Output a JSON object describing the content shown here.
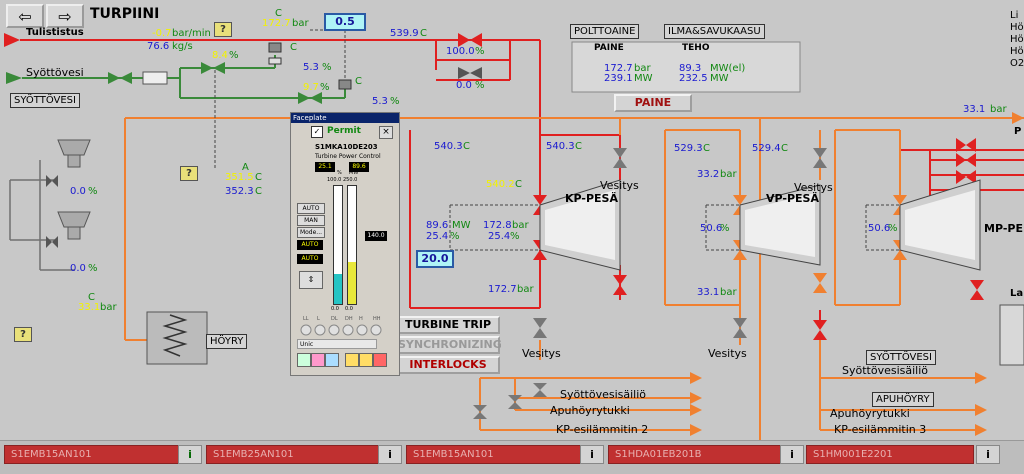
{
  "header": {
    "title": "TURPIINI",
    "back_label": "⇦",
    "forward_label": "⇨",
    "corner_label": "0.5"
  },
  "help_label": "?",
  "colors": {
    "background": "#c8c8c8",
    "red_line": "#e02020",
    "orange_line": "#f08030",
    "green_line": "#3a8a3a",
    "value_blue": "#1a1ad0",
    "value_yellow": "#f2f200",
    "alarm_red": "#c03030"
  },
  "top": {
    "tulististus": "Tulististus",
    "rate": "-0.7",
    "rate_unit": "bar/min",
    "flow": "76.6",
    "flow_unit": "kg/s",
    "valve_pct": "8.4",
    "pct_unit": "%",
    "p_top": "172.7",
    "p_top_unit": "bar",
    "c_lbl": "C",
    "p_temp": "539.9",
    "c_unit": "C",
    "pct_a": "5.3",
    "pct_b": "9.7",
    "pct_c": "5.3",
    "bypass_a": "100.0",
    "bypass_b": "0.0",
    "syottovesi": "Syöttövesi",
    "syottovesi_tag": "SYÖTTÖVESI"
  },
  "polttoaine": {
    "title_a": "POLTTOAINE",
    "title_b": "ILMA&SAVUKAASU",
    "paine_hdr": "PAINE",
    "teho_hdr": "TEHO",
    "paine1": "172.7",
    "paine1_unit": "bar",
    "paine2": "239.1",
    "paine2_unit": "MW",
    "teho1": "89.3",
    "teho1_unit": "MW(el)",
    "teho2": "232.5",
    "teho2_unit": "MW",
    "button": "PAINE"
  },
  "right_edge": {
    "labels": [
      "Li",
      "Hö",
      "Hö",
      "Hö",
      "O2"
    ],
    "value": "33.1",
    "unit": "bar",
    "pest_label": "P",
    "la_label": "La"
  },
  "left": {
    "pct1": "0.0",
    "pct2": "0.0",
    "pct_unit": "%",
    "temp_a_lbl": "A",
    "temp_a": "351.5",
    "temp_b": "352.3",
    "c_unit": "C",
    "p_small_lbl": "C",
    "p_small": "33.1",
    "bar_unit": "bar",
    "hoyry": "HÖYRY"
  },
  "faceplate": {
    "title": "Faceplate",
    "permit": "Permit",
    "close": "×",
    "tag": "S1MKA10DE203",
    "desc": "Turbine Power Control",
    "val_left": "25.1",
    "val_right": "89.6",
    "unit_left": "%",
    "unit_right": "MW",
    "scale_top": "100.0",
    "scale_top2": "250.0",
    "setpoint": "140.0",
    "btn_auto": "AUTO",
    "btn_man": "MAN",
    "btn_mode": "Mode...",
    "status_auto1": "AUTO",
    "status_auto2": "AUTO",
    "zero_a": "0.0",
    "zero_b": "0.0",
    "leds": [
      "LL",
      "L",
      "DL",
      "DH",
      "H",
      "HH"
    ],
    "unit_box": "Unic"
  },
  "buttons": {
    "trip": "TURBINE TRIP",
    "sync": "SYNCHRONIZING",
    "interlocks": "INTERLOCKS"
  },
  "kp": {
    "label": "KP-PESÄ",
    "t1": "540.3",
    "t2": "540.3",
    "t_yel": "540.2",
    "c_unit": "C",
    "mw": "89.6",
    "mw_unit": "MW",
    "pct_l": "25.4",
    "pct_unit": "%",
    "bar_r": "172.8",
    "bar_unit": "bar",
    "pct_r": "25.4",
    "setpoint": "20.0",
    "bar_bottom": "172.7",
    "vesitys1": "Vesitys",
    "vesitys2": "Vesitys"
  },
  "vp": {
    "label": "VP-PESÄ",
    "t1": "529.3",
    "t2": "529.4",
    "c_unit": "C",
    "bar_a": "33.2",
    "bar_unit": "bar",
    "pct": "50.6",
    "pct_unit": "%",
    "bar_b": "33.1",
    "vesitys1": "Vesitys",
    "vesitys2": "Vesitys"
  },
  "mp": {
    "label": "MP-PE",
    "pct": "50.6",
    "pct_unit": "%"
  },
  "outlets": {
    "left": [
      "Syöttövesisäiliö",
      "Apuhöyrytukki",
      "KP-esilämmitin 2"
    ],
    "right": [
      "Syöttövesisäiliö",
      "Apuhöyrytukki",
      "KP-esilämmitin 3"
    ],
    "tag_syottovesi": "SYÖTTÖVESI",
    "tag_apuhoyry": "APUHÖYRY"
  },
  "alarms": [
    {
      "tag": "S1EMB15AN101"
    },
    {
      "tag": "S1EMB25AN101"
    },
    {
      "tag": "S1EMB15AN101"
    },
    {
      "tag": "S1HDA01EB201B"
    },
    {
      "tag": "S1HM001E2201"
    }
  ],
  "info_label": "i"
}
